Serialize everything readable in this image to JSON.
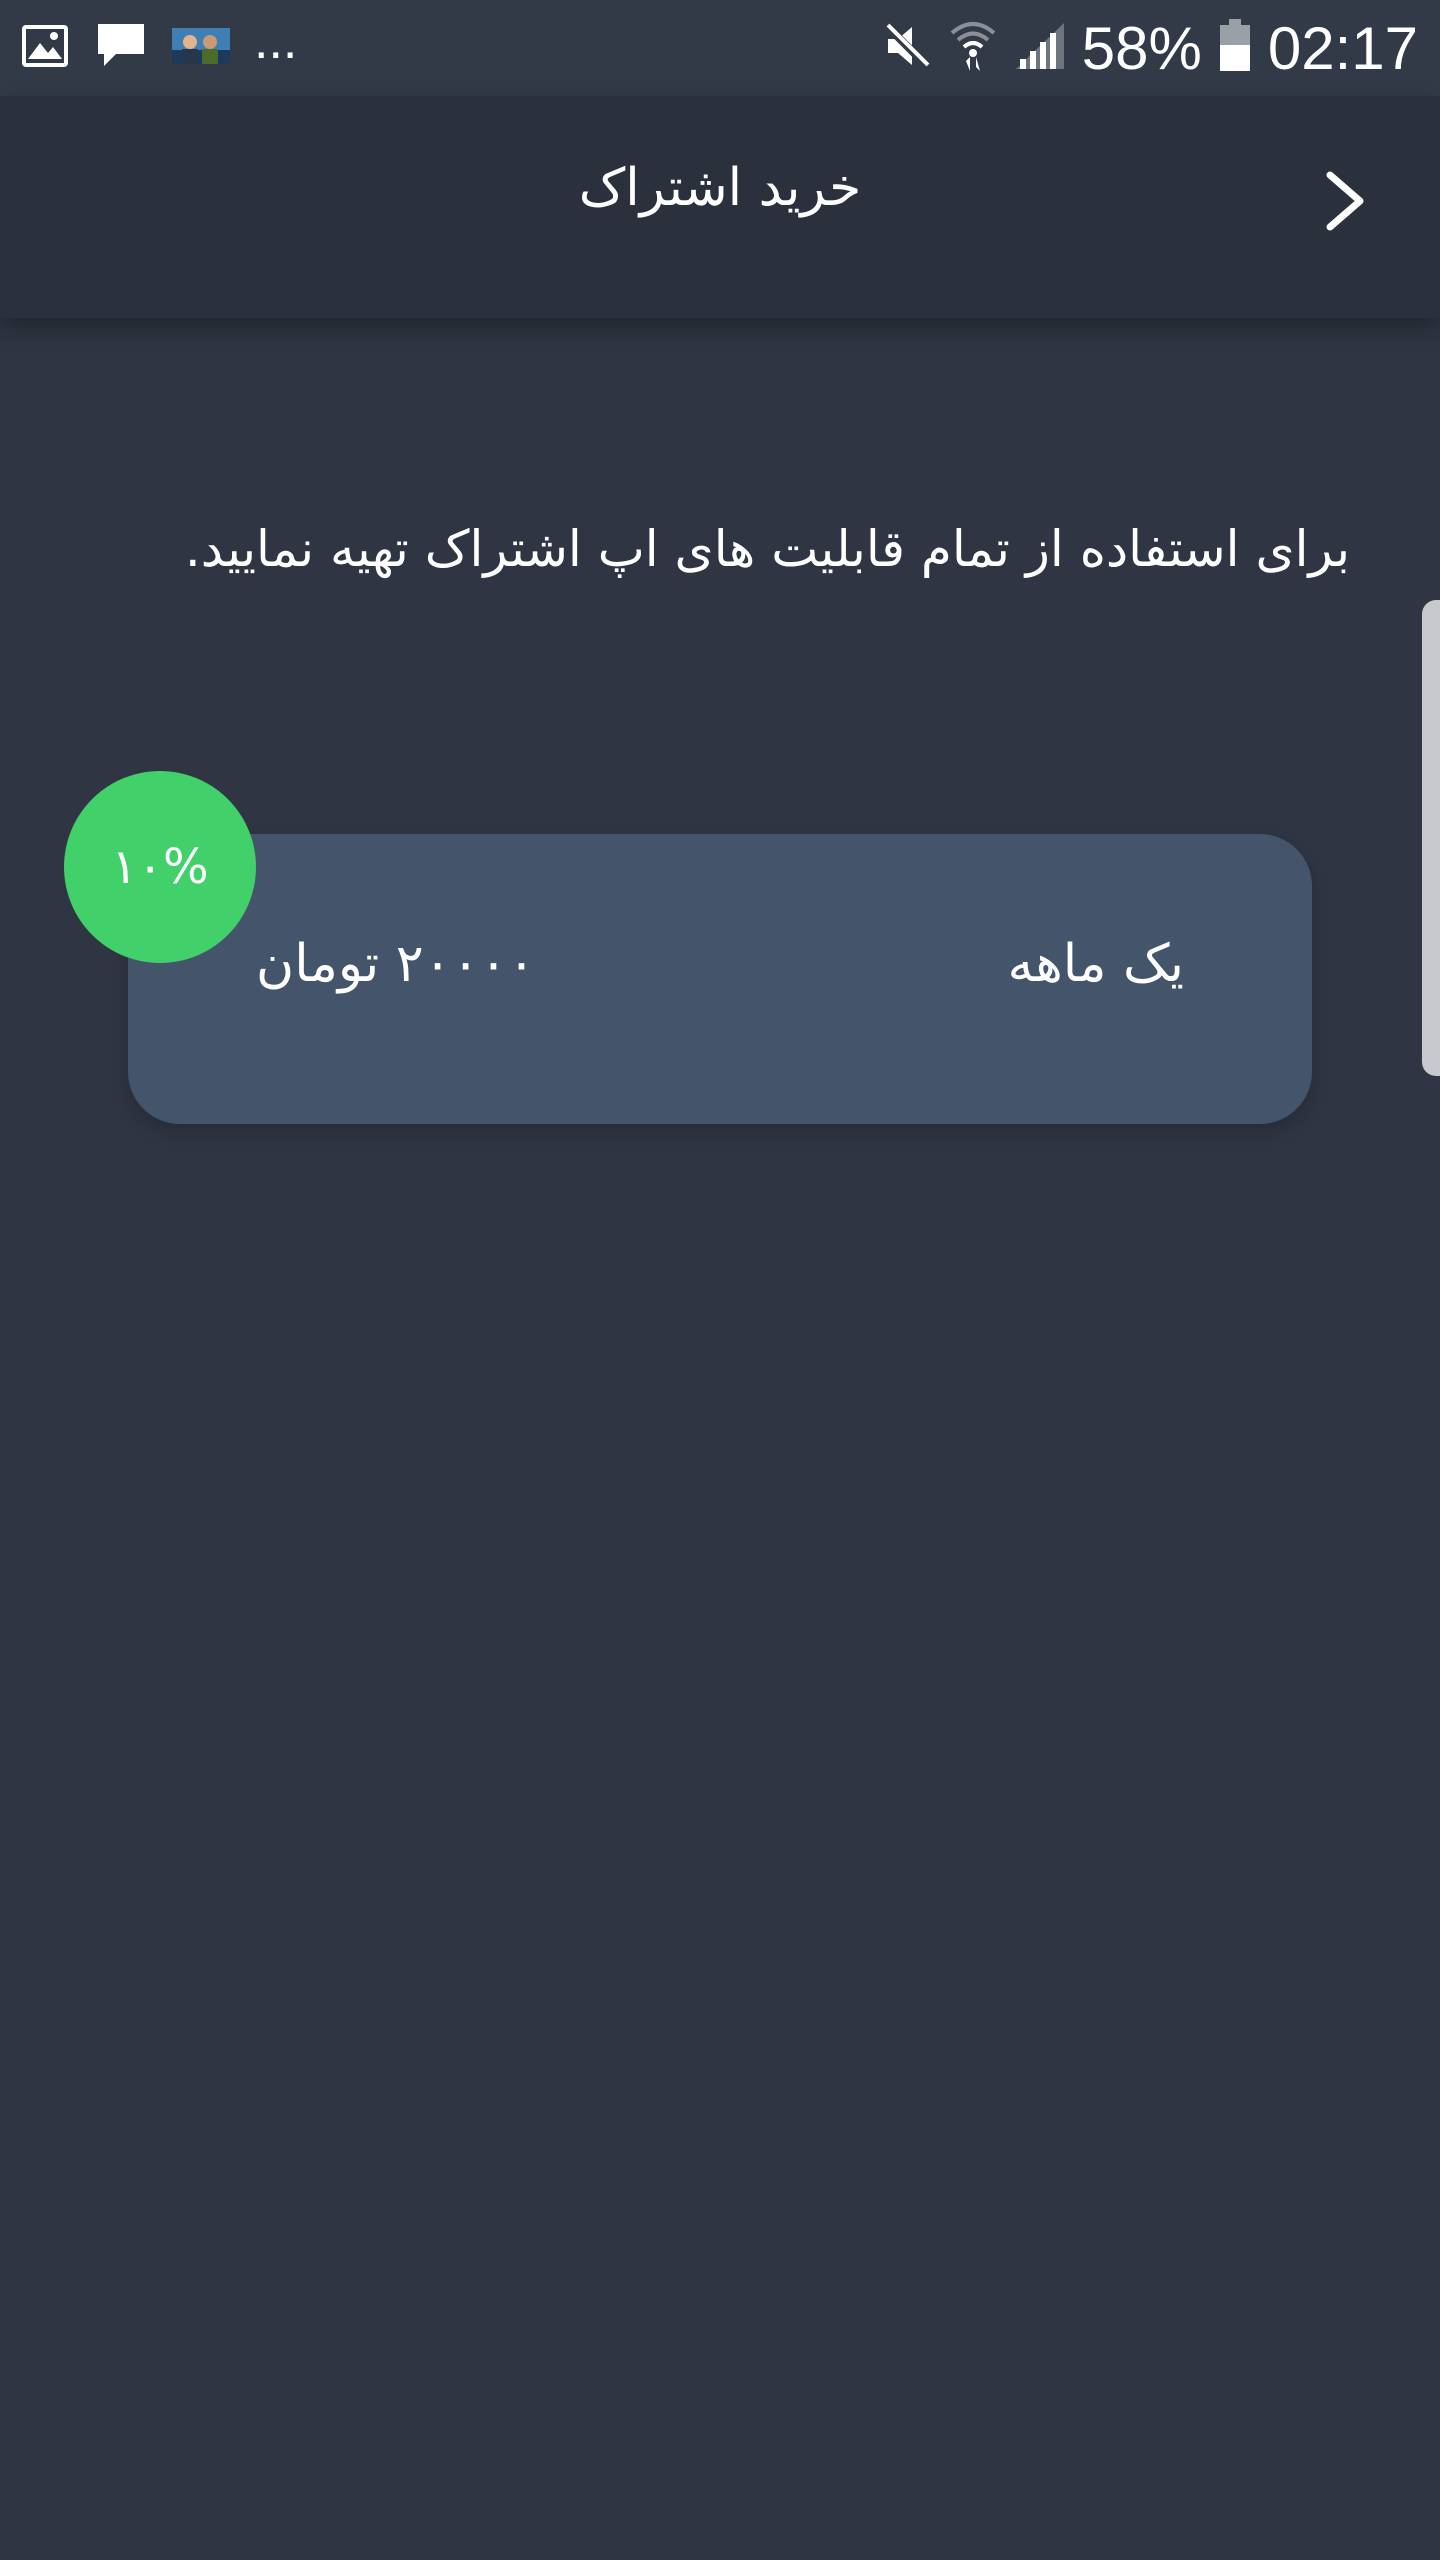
{
  "status_bar": {
    "icons_left": [
      "gallery-icon",
      "message-icon",
      "app-thumbnail-icon"
    ],
    "overflow": "...",
    "icons_right": [
      "mute-icon",
      "wifi-icon",
      "signal-icon",
      "battery-icon"
    ],
    "battery": "58%",
    "time": "02:17"
  },
  "header": {
    "title": "خرید اشتراک",
    "back_icon": "chevron-right-icon"
  },
  "intro_text": "برای استفاده از تمام قابلیت های اپ اشتراک تهیه نمایید.",
  "plans": [
    {
      "duration": "یک ماهه",
      "price": "۲۰۰۰۰ تومان",
      "discount": "۱۰%"
    }
  ],
  "colors": {
    "background": "#2f3543",
    "app_bar": "#2a313d",
    "card": "#44556b",
    "badge": "#41d06a",
    "text": "#ffffff"
  }
}
